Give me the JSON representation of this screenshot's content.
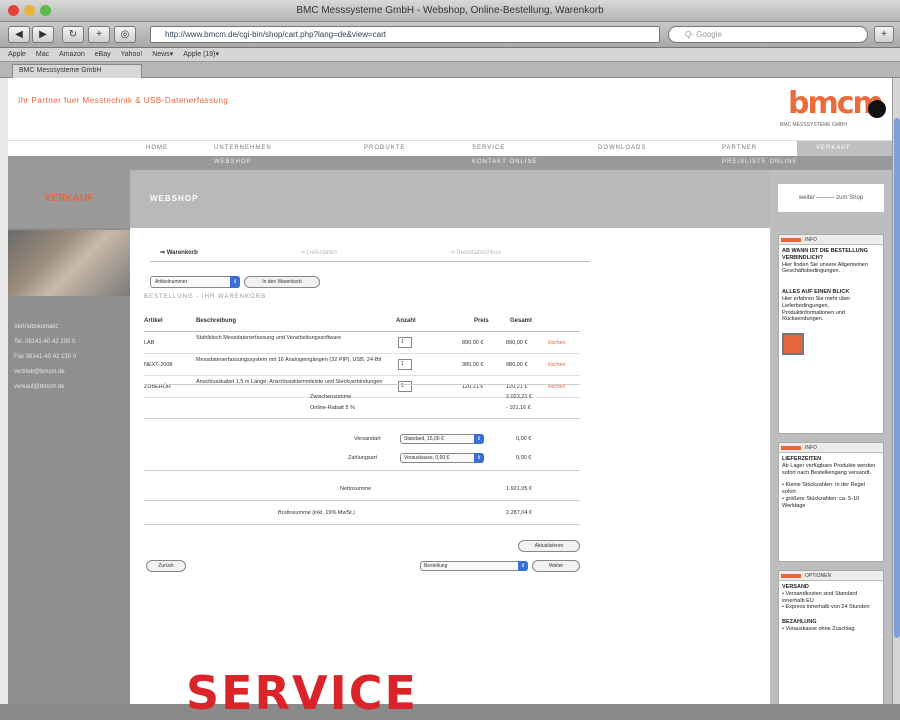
{
  "window": {
    "title": "BMC Messsysteme GmbH - Webshop, Online-Bestellung, Warenkorb"
  },
  "toolbar": {
    "back": "◀",
    "forward": "▶",
    "refresh": "↻",
    "tab": "+",
    "url": "http://www.bmcm.de/cgi-bin/shop/cart.php?lang=de&view=cart",
    "search": "Q- Google",
    "reader": "◎"
  },
  "bookmarks": [
    "Apple",
    "Mac",
    "Amazon",
    "eBay",
    "Yahoo!",
    "News▾",
    "Apple (19)▾"
  ],
  "tab": {
    "label": "BMC Messsysteme GmbH"
  },
  "header": {
    "slogan": "Ihr Partner fuer Messtechnik & USB-Datenerfassung",
    "logo": "bmcm",
    "logo_sub": "BMC MESSSYSTEME GMBH"
  },
  "nav": [
    "HOME",
    "UNTERNEHMEN",
    "PRODUKTE",
    "SERVICE",
    "DOWNLOADS",
    "PARTNER",
    "VERKAUF"
  ],
  "subnav": [
    "WEBSHOP",
    "KONTAKT ONLINE",
    "PREISLISTE ONLINE"
  ],
  "sidebar": {
    "title": "VERKAUF",
    "contact": [
      "Vertriebskontakt:",
      "Tel. 08141-40 42 100 0",
      "Fax 08141-40 42 130 0",
      "vertrieb@bmcm.de",
      "verkauf@bmcm.de"
    ]
  },
  "banner": {
    "title": "WEBSHOP"
  },
  "steps": [
    "Warenkorb",
    "Lieferdaten",
    "Bestellabschluss"
  ],
  "main": {
    "sel1": "Artikelnummer",
    "btn1": "In den Warenkorb",
    "section": "BESTELLUNG - IHR WARENKORB"
  },
  "table": {
    "headers": [
      "Artikel",
      "Beschreibung",
      "Anzahl",
      "Preis",
      "Gesamt"
    ],
    "rows": [
      {
        "art": "LAB",
        "desc": "Stahlblech Messdatenerfassung und Verarbeitungssoftware",
        "qty": "1",
        "price": "890,00 €",
        "total": "890,00 €",
        "del": "löschen"
      },
      {
        "art": "NEXT-2008",
        "desc": "Messdatenerfassungssystem mit 16 Analogeingängen (32 PIP), USB, 24-Bit",
        "qty": "1",
        "price": "980,00 €",
        "total": "980,00 €",
        "del": "löschen"
      },
      {
        "art": "ZUBEHÖR",
        "desc": "Anschlusskabel 1,5 m Länge; Anschlussklemmleiste und Steckverbindungen",
        "qty": "1",
        "price": "120,21 €",
        "total": "120,21 €",
        "del": "löschen"
      }
    ]
  },
  "sums": {
    "zw_label": "Zwischensumme",
    "zw": "2.023,21 €",
    "rabatt_label": "Online-Rabatt 5 %",
    "rabatt": "- 101,16 €",
    "versand_label": "Versandart",
    "versand_sel": "Standard, 15,00 €",
    "versand": "0,00 €",
    "zahl_label": "Zahlungsart",
    "zahl_sel": "Vorauskasse, 0,00 €",
    "zahl": "0,00 €",
    "netto_label": "Nettosumme",
    "netto": "1.921,05 €",
    "brutto_label": "Bruttosumme (inkl. 19% MwSt.)",
    "brutto": "2.287,04 €"
  },
  "buttons": {
    "recalc": "Aktualisieren",
    "back": "Zurück",
    "continue": "Weiter",
    "bottom_sel": "Bestellung"
  },
  "right": {
    "top": "weiter ——— zum Shop",
    "box1_head": "INFO",
    "box1_t1": "AB WANN IST DIE BESTELLUNG VERBINDLICH?",
    "box1_b1": "Hier finden Sie unsere Allgemeinen Geschäftsbedingungen.",
    "box1_t2": "ALLES AUF EINEN BLICK",
    "box1_b2": "Hier erfahren Sie mehr über Lieferbedingungen, Produktinformationen und Rücksendungen.",
    "box2_head": "INFO",
    "box2_t1": "LIEFERZEITEN",
    "box2_b1": "Ab Lager verfügbare Produkte werden sofort nach Bestelleingang versandt.",
    "box2_b2": "• Kleine Stückzahlen: in der Regel sofort",
    "box2_b3": "• größere Stückzahlen: ca. 5-10 Werktage",
    "box3_head": "OPTIONEN",
    "box3_t1": "VERSAND",
    "box3_b1": "• Versandkosten sind Standard innerhalb EU",
    "box3_b2": "• Express innerhalb von 24 Stunden",
    "box3_t2": "BEZAHLUNG",
    "box3_b3": "• Vorauskasse ohne Zuschlag"
  },
  "overlay": {
    "text": "SERVICE"
  },
  "colors": {
    "accent": "#e8643c",
    "service_red": "#d9252a",
    "sidebar_gray": "#8f8f8f",
    "select_blue": "#3a6fd8"
  }
}
